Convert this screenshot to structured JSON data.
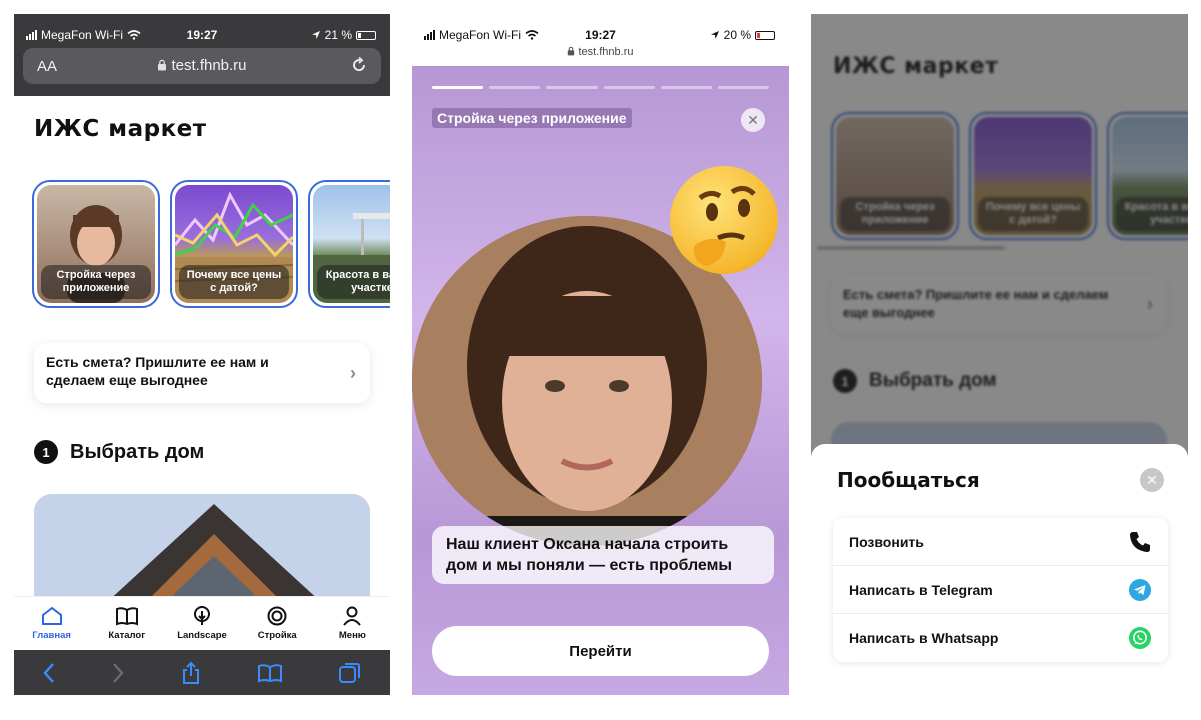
{
  "status": {
    "carrier": "MegaFon Wi-Fi",
    "time": "19:27",
    "battery_left": "21 %",
    "battery_mid": "20 %"
  },
  "browser": {
    "aa_label": "AA",
    "url": "test.fhnb.ru"
  },
  "site": {
    "title": "ИЖС маркет",
    "stories": [
      {
        "label": "Стройка через приложение"
      },
      {
        "label": "Почему все цены с датой?"
      },
      {
        "label": "Красота в вашем участке"
      }
    ],
    "promo": "Есть смета? Пришлите ее нам и сделаем еще выгоднее",
    "section_number": "1",
    "section_title": "Выбрать дом"
  },
  "tabbar": {
    "items": [
      {
        "label": "Главная",
        "icon": "home-icon",
        "active": true
      },
      {
        "label": "Каталог",
        "icon": "book-icon",
        "active": false
      },
      {
        "label": "Landscape",
        "icon": "tree-icon",
        "active": false
      },
      {
        "label": "Стройка",
        "icon": "target-icon",
        "active": false
      },
      {
        "label": "Меню",
        "icon": "user-icon",
        "active": false
      }
    ]
  },
  "story_view": {
    "label": "Стройка через приложение",
    "segments": 6,
    "active_segment": 1,
    "quote": "Наш клиент Оксана начала строить дом и мы поняли — есть проблемы",
    "button": "Перейти"
  },
  "contact_sheet": {
    "title": "Пообщаться",
    "options": [
      {
        "label": "Позвонить",
        "icon": "phone-icon"
      },
      {
        "label": "Написать в Telegram",
        "icon": "telegram-icon"
      },
      {
        "label": "Написать в Whatsapp",
        "icon": "whatsapp-icon"
      }
    ]
  },
  "colors": {
    "accent": "#2f66e0",
    "story_border": "#3a6bd8",
    "telegram": "#2ea6e0",
    "whatsapp": "#25d366"
  }
}
